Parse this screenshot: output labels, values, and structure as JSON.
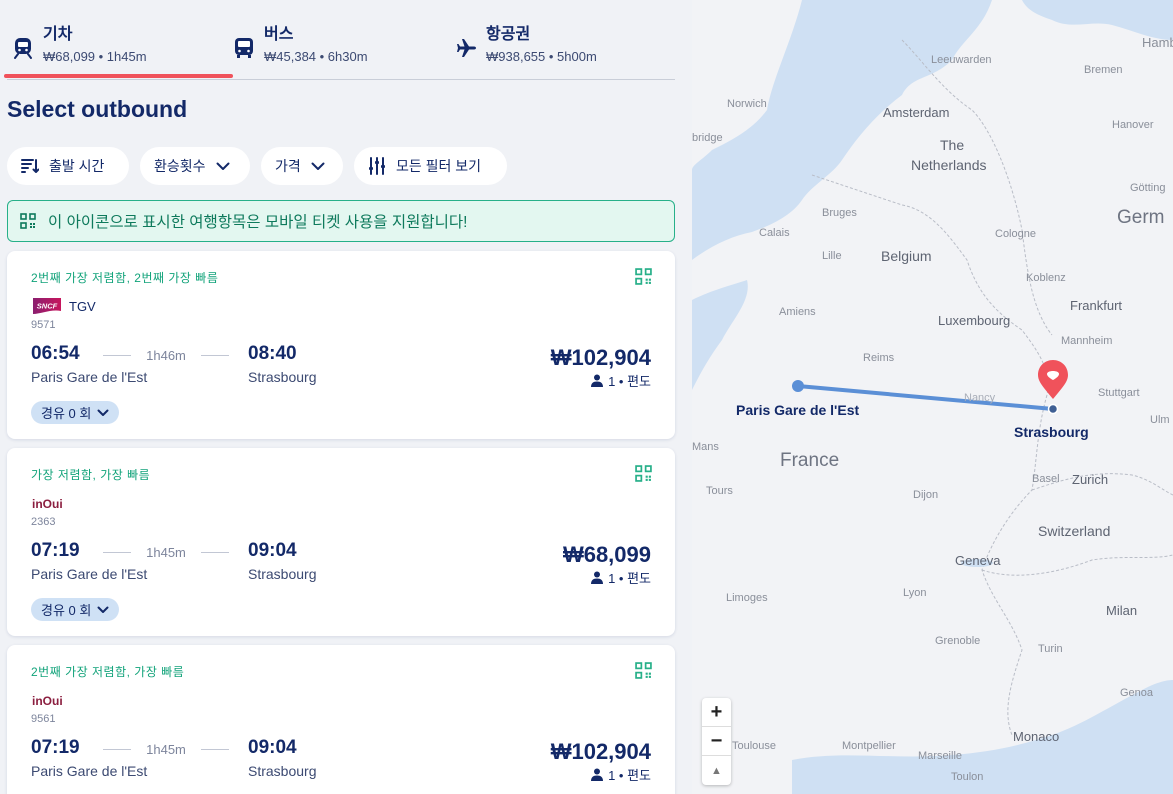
{
  "tabs": [
    {
      "icon": "train-icon",
      "label": "기차",
      "info": "₩68,099 • 1h45m",
      "active": true
    },
    {
      "icon": "bus-icon",
      "label": "버스",
      "info": "₩45,384 • 6h30m",
      "active": false
    },
    {
      "icon": "plane-icon",
      "label": "항공권",
      "info": "₩938,655 • 5h00m",
      "active": false
    }
  ],
  "page_title": "Select outbound",
  "filters": {
    "departure_time": "출발 시간",
    "transfers": "환승횟수",
    "price": "가격",
    "all_filters": "모든 필터 보기"
  },
  "banner": "이 아이콘으로 표시한 여행항목은 모바일 티켓 사용을 지원합니다!",
  "results": [
    {
      "badge": "2번째 가장 저렴함, 2번째 가장 빠름",
      "carrier_logo": "SNCF",
      "carrier": "TGV",
      "train_number": "9571",
      "departure_time": "06:54",
      "departure_station": "Paris Gare de l'Est",
      "duration": "1h46m",
      "arrival_time": "08:40",
      "arrival_station": "Strasbourg",
      "price": "₩102,904",
      "passengers": "1 • 편도",
      "stops": "경유 0 회"
    },
    {
      "badge": "가장 저렴함, 가장 빠름",
      "carrier_logo": "inOui",
      "carrier": "",
      "train_number": "2363",
      "departure_time": "07:19",
      "departure_station": "Paris Gare de l'Est",
      "duration": "1h45m",
      "arrival_time": "09:04",
      "arrival_station": "Strasbourg",
      "price": "₩68,099",
      "passengers": "1 • 편도",
      "stops": "경유 0 회"
    },
    {
      "badge": "2번째 가장 저렴함, 가장 빠름",
      "carrier_logo": "inOui",
      "carrier": "",
      "train_number": "9561",
      "departure_time": "07:19",
      "departure_station": "Paris Gare de l'Est",
      "duration": "1h45m",
      "arrival_time": "09:04",
      "arrival_station": "Strasbourg",
      "price": "₩102,904",
      "passengers": "1 • 편도",
      "stops": "경유 0 회"
    }
  ],
  "map": {
    "origin": "Paris Gare de l'Est",
    "destination": "Strasbourg",
    "route_color": "#5b8fd6",
    "pin_color": "#f0525b",
    "labels": {
      "hamburg": "Hamb",
      "bremen": "Bremen",
      "leeuwarden": "Leeuwarden",
      "norwich": "Norwich",
      "amsterdam": "Amsterdam",
      "hanover": "Hanover",
      "bridge": "bridge",
      "the": "The",
      "netherlands": "Netherlands",
      "gottingen": "Götting",
      "germany": "Germ",
      "bruges": "Bruges",
      "calais": "Calais",
      "cologne": "Cologne",
      "lille": "Lille",
      "belgium": "Belgium",
      "koblenz": "Koblenz",
      "frankfurt": "Frankfurt",
      "amiens": "Amiens",
      "luxembourg": "Luxembourg",
      "mannheim": "Mannheim",
      "reims": "Reims",
      "stuttgart": "Stuttgart",
      "nancy": "Nancy",
      "ulm": "Ulm",
      "mans": "Mans",
      "france": "France",
      "tours": "Tours",
      "basel": "Basel",
      "zurich": "Zurich",
      "dijon": "Dijon",
      "switzerland": "Switzerland",
      "geneva": "Geneva",
      "limoges": "Limoges",
      "lyon": "Lyon",
      "milan": "Milan",
      "grenoble": "Grenoble",
      "turin": "Turin",
      "genoa": "Genoa",
      "toulouse": "Toulouse",
      "montpellier": "Montpellier",
      "marseille": "Marseille",
      "monaco": "Monaco",
      "toulon": "Toulon"
    },
    "zoom_in": "+",
    "zoom_out": "−",
    "reset": "▲"
  }
}
